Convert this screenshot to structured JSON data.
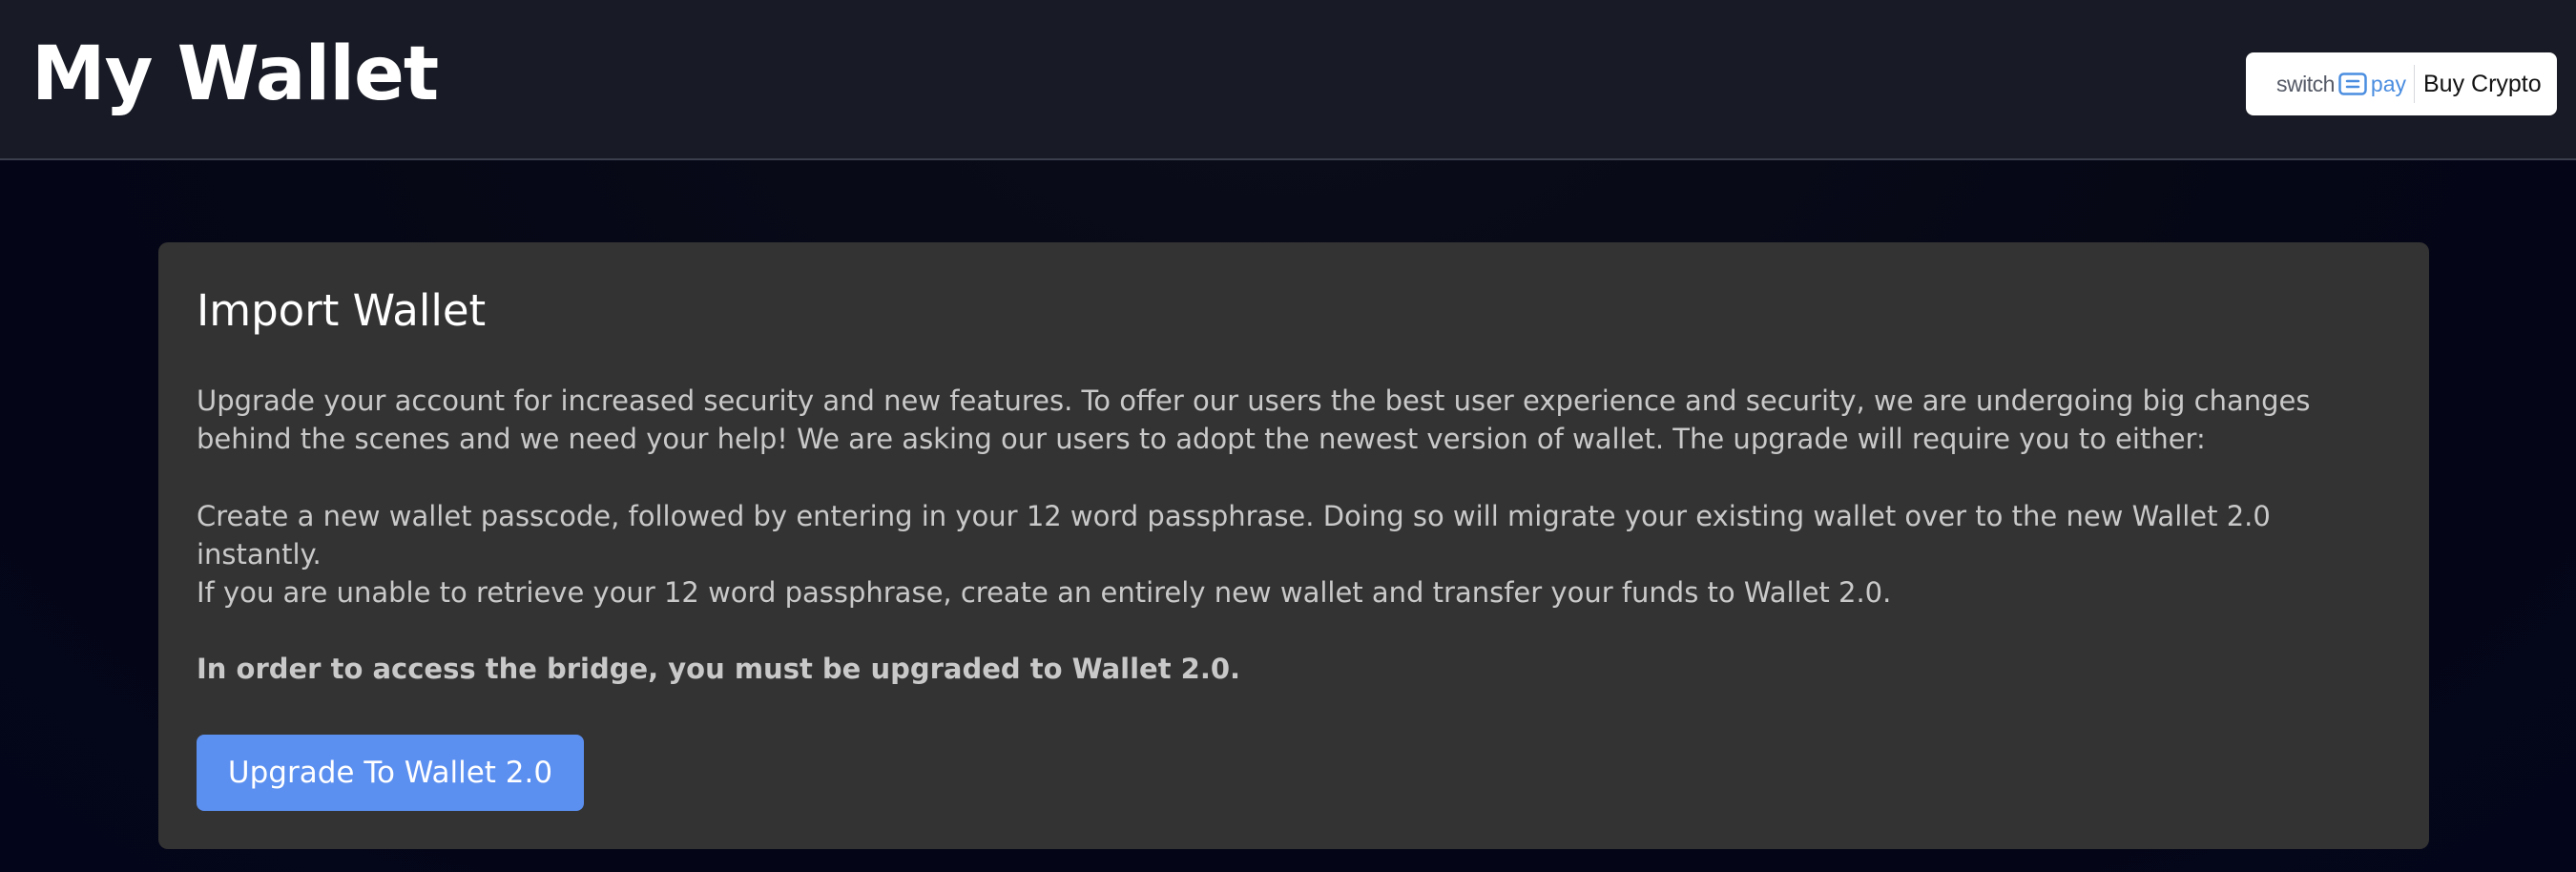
{
  "header": {
    "title": "My Wallet",
    "buy_button": {
      "brand_switch": "switch",
      "brand_pay": "pay",
      "brand_icon": "switchpay-logo-icon",
      "label": "Buy Crypto"
    }
  },
  "card": {
    "title": "Import Wallet",
    "paragraphs": [
      "Upgrade your account for increased security and new features. To offer our users the best user experience and security, we are undergoing big changes behind the scenes and we need your help! We are asking our users to adopt the newest version of wallet. The upgrade will require you to either:",
      "Create a new wallet passcode, followed by entering in your 12 word passphrase. Doing so will migrate your existing wallet over to the new Wallet 2.0 instantly.",
      "If you are unable to retrieve your 12 word passphrase, create an entirely new wallet and transfer your funds to Wallet 2.0.",
      "In order to access the bridge, you must be upgraded to Wallet 2.0."
    ],
    "upgrade_button": "Upgrade To Wallet 2.0"
  },
  "colors": {
    "header_bg": "#181b25",
    "card_bg": "#333333",
    "accent": "#5b8ff0",
    "brand_blue": "#4a8de0"
  }
}
